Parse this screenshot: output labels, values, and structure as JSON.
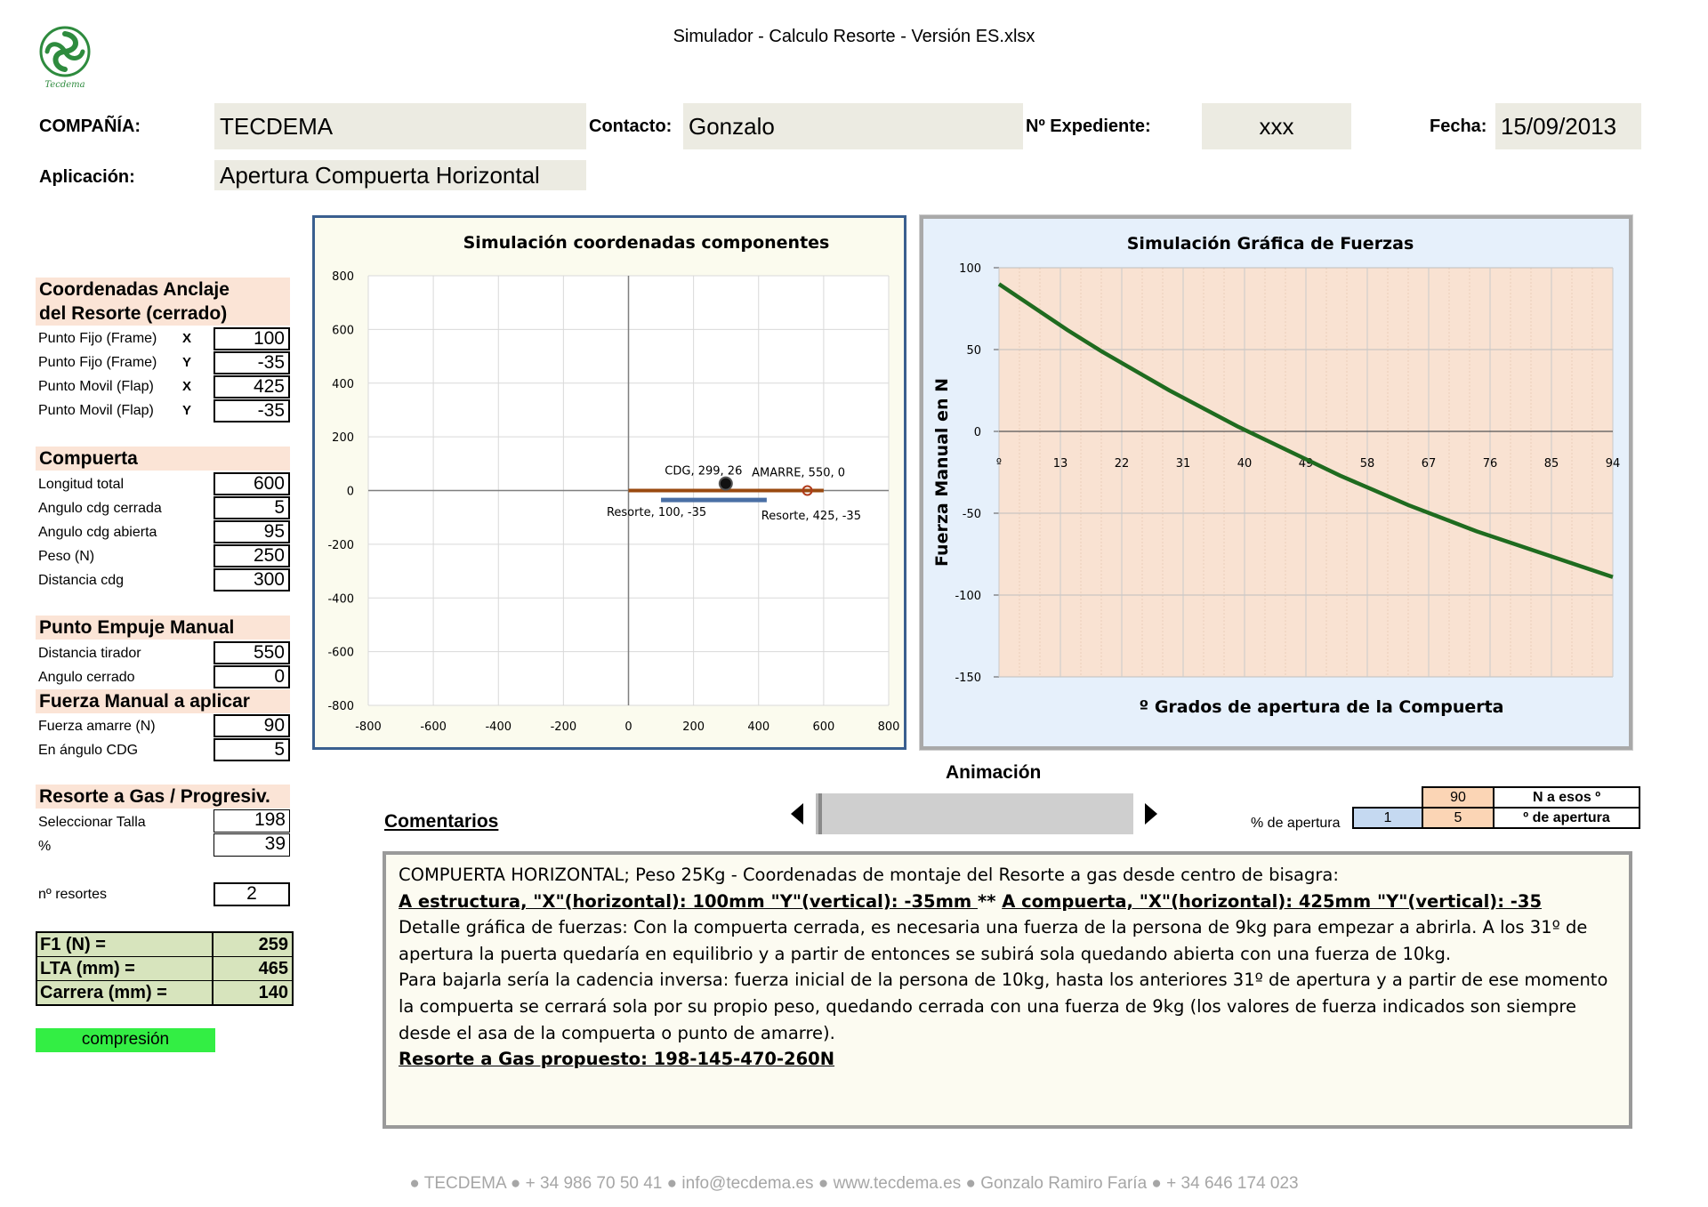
{
  "document": {
    "title": "Simulador - Calculo Resorte - Versión ES.xlsx",
    "logo_text": "Tecdema"
  },
  "header": {
    "company_label": "COMPAÑÍA:",
    "company_value": "TECDEMA",
    "contact_label": "Contacto:",
    "contact_value": "Gonzalo",
    "file_label": "Nº Expediente:",
    "file_value": "xxx",
    "date_label": "Fecha:",
    "date_value": "15/09/2013",
    "application_label": "Aplicación:",
    "application_value": "Apertura Compuerta Horizontal"
  },
  "left_panel": {
    "anchor": {
      "heading_line1": "Coordenadas Anclaje",
      "heading_line2": "del Resorte (cerrado)",
      "rows": [
        {
          "label": "Punto Fijo (Frame)",
          "axis": "X",
          "value": "100"
        },
        {
          "label": "Punto Fijo (Frame)",
          "axis": "Y",
          "value": "-35"
        },
        {
          "label": "Punto Movil (Flap)",
          "axis": "X",
          "value": "425"
        },
        {
          "label": "Punto Movil (Flap)",
          "axis": "Y",
          "value": "-35"
        }
      ]
    },
    "gate": {
      "heading": "Compuerta",
      "rows": [
        {
          "label": "Longitud total",
          "value": "600"
        },
        {
          "label": "Angulo cdg cerrada",
          "value": "5"
        },
        {
          "label": "Angulo cdg abierta",
          "value": "95"
        },
        {
          "label": "Peso (N)",
          "value": "250"
        },
        {
          "label": "Distancia cdg",
          "value": "300"
        }
      ]
    },
    "push_point": {
      "heading": "Punto Empuje Manual",
      "rows": [
        {
          "label": "Distancia tirador",
          "value": "550"
        },
        {
          "label": "Angulo cerrado",
          "value": "0"
        }
      ]
    },
    "manual_force": {
      "heading": "Fuerza Manual a aplicar",
      "rows": [
        {
          "label": "Fuerza amarre (N)",
          "value": "90"
        },
        {
          "label": "En ángulo CDG",
          "value": "5"
        }
      ]
    },
    "gas_spring": {
      "heading": "Resorte a Gas / Progresiv.",
      "rows": [
        {
          "label": "Seleccionar Talla",
          "value": "198"
        },
        {
          "label": "%",
          "value": "39"
        }
      ],
      "count_label": "nº resortes",
      "count_value": "2"
    },
    "results": [
      {
        "label": "F1 (N) =",
        "value": "259"
      },
      {
        "label": "LTA (mm) =",
        "value": "465"
      },
      {
        "label": "Carrera (mm) =",
        "value": "140"
      }
    ],
    "status": "compresión",
    "status_color": "#33ee44"
  },
  "chart_data": [
    {
      "type": "scatter",
      "title": "Simulación coordenadas componentes",
      "xlim": [
        -800,
        800
      ],
      "ylim": [
        -800,
        800
      ],
      "x_ticks": [
        "-800",
        "-600",
        "-400",
        "-200",
        "0",
        "200",
        "400",
        "600",
        "800"
      ],
      "y_ticks": [
        "800",
        "600",
        "400",
        "200",
        "0",
        "-200",
        "-400",
        "-600",
        "-800"
      ],
      "grid": true,
      "series": [
        {
          "name": "",
          "x": [
            0,
            600
          ],
          "y": [
            0,
            0
          ],
          "color": "#9a4a10"
        },
        {
          "name": "",
          "x": [
            100,
            425
          ],
          "y": [
            -35,
            -35
          ],
          "color": "#4a6fa5"
        }
      ],
      "points": [
        {
          "label": "CDG, 299, 26",
          "x": 299,
          "y": 26
        },
        {
          "label": "AMARRE, 550, 0",
          "x": 550,
          "y": 0
        },
        {
          "label": "Resorte, 100, -35",
          "x": 100,
          "y": -35
        },
        {
          "label": "Resorte, 425, -35",
          "x": 425,
          "y": -35
        }
      ],
      "background": "#fbfbee"
    },
    {
      "type": "line",
      "title": "Simulación Gráfica de Fuerzas",
      "xlabel": "º Grados de apertura de la Compuerta",
      "ylabel": "Fuerza Manual en N",
      "x_ticks": [
        "º",
        "13",
        "22",
        "31",
        "40",
        "49",
        "58",
        "67",
        "76",
        "85",
        "94"
      ],
      "y_ticks": [
        "100",
        "50",
        "0",
        "-50",
        "-100",
        "-150"
      ],
      "ylim": [
        -150,
        100
      ],
      "xlim": [
        5,
        95
      ],
      "grid": true,
      "series": [
        {
          "name": "",
          "color": "#1f6b1f",
          "x": [
            5,
            10,
            15,
            20,
            25,
            30,
            35,
            40,
            45,
            50,
            55,
            60,
            65,
            70,
            75,
            80,
            85,
            90,
            95
          ],
          "y": [
            90,
            76,
            62,
            49,
            37,
            25,
            14,
            3,
            -7,
            -17,
            -27,
            -36,
            -45,
            -53,
            -61,
            -68,
            -75,
            -82,
            -89
          ]
        }
      ],
      "background": "#f9e2d2"
    }
  ],
  "animation": {
    "label": "Animación",
    "comments_label": "Comentarios",
    "scroll_value_fraction": 0.0,
    "table": {
      "top_value": "90",
      "top_desc": "N a esos º",
      "row_label": "% de apertura",
      "row_input": "1",
      "row_value": "5",
      "row_desc": "º de apertura"
    }
  },
  "comments": {
    "line1": "COMPUERTA HORIZONTAL;  Peso 25Kg - Coordenadas de montaje del  Resorte a gas desde centro de bisagra:",
    "line2a": "A estructura, \"X\"(horizontal): 100mm  \"Y\"(vertical): -35mm ",
    "line2b": "** ",
    "line2c": "A compuerta, \"X\"(horizontal): 425mm  \"Y\"(vertical): -35",
    "para1": "Detalle gráfica de fuerzas: Con la compuerta cerrada, es necesaria una fuerza de la persona de 9kg para empezar a abrirla. A los 31º de apertura la puerta quedaría en equilibrio y a partir de entonces se subirá sola quedando abierta con una fuerza de 10kg.",
    "para2": "Para bajarla sería la cadencia inversa: fuerza inicial de la persona de 10kg, hasta los anteriores 31º de apertura y a partir de ese momento la compuerta  se cerrará sola por su propio peso, quedando cerrada con una fuerza de 9kg (los valores de fuerza indicados son siempre desde el asa de la compuerta o punto de amarre).",
    "proposal": "Resorte a Gas propuesto:  198-145-470-260N"
  },
  "footer": "● TECDEMA ● + 34 986 70 50 41 ● info@tecdema.es ● www.tecdema.es ● Gonzalo Ramiro Faría ● + 34 646 174 023"
}
